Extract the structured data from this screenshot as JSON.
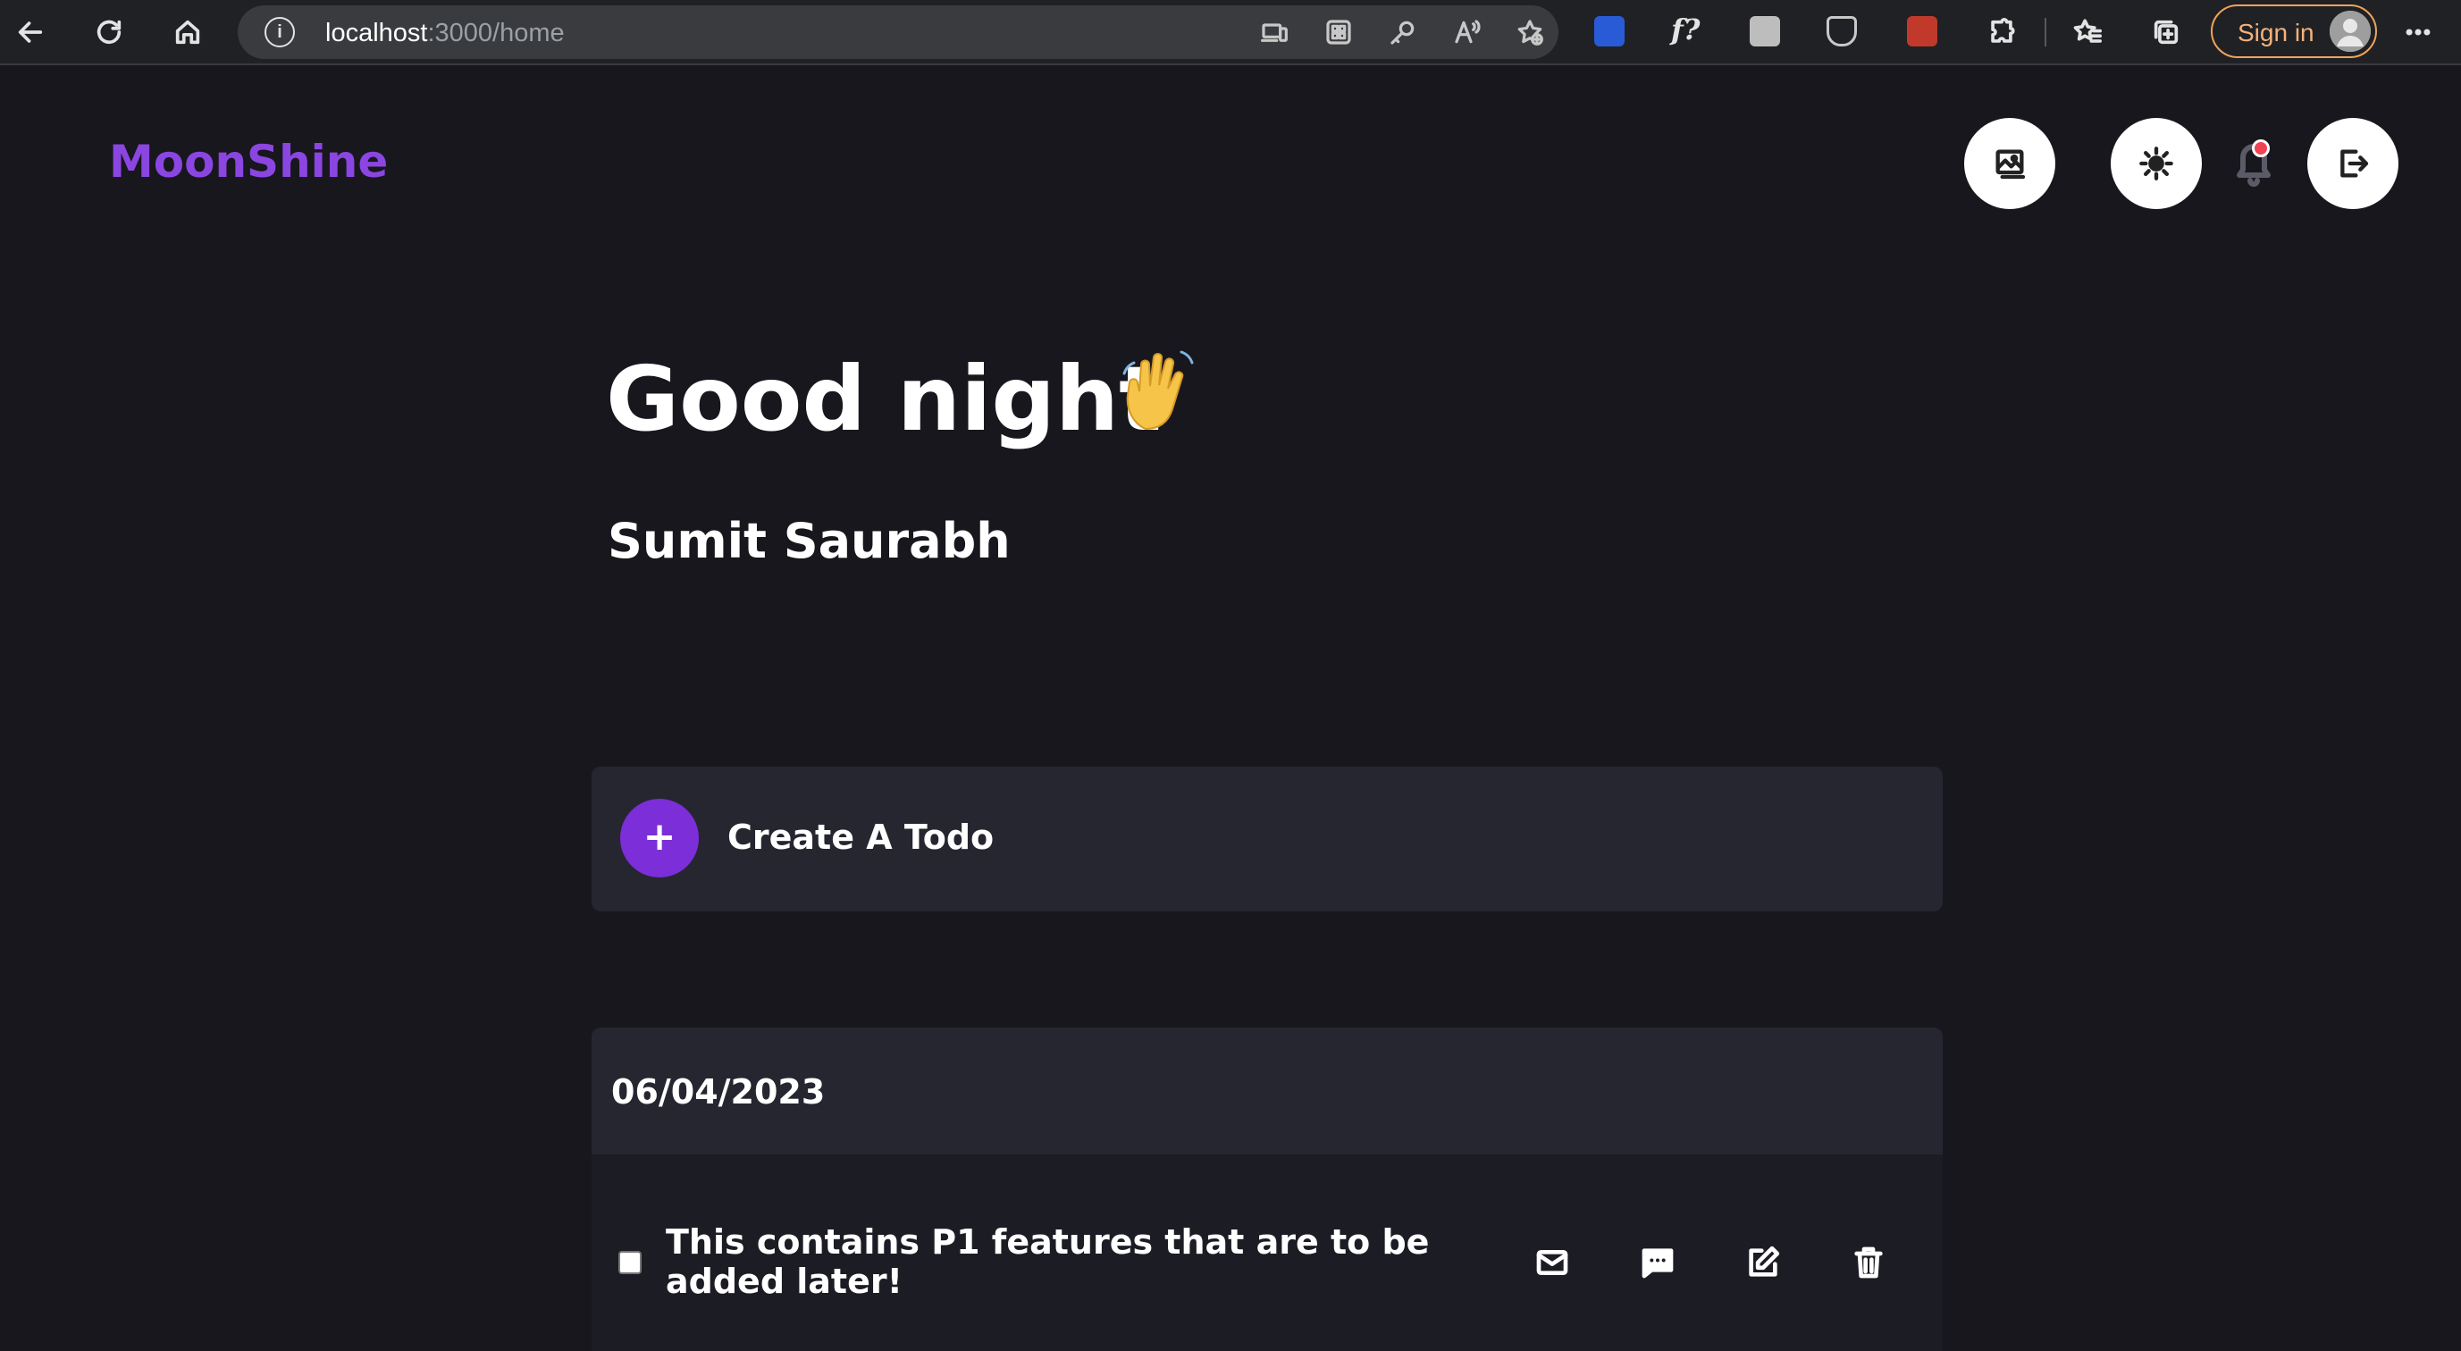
{
  "browser": {
    "url_host": "localhost",
    "url_path": ":3000/home",
    "signin_label": "Sign in",
    "icons": [
      "back-icon",
      "refresh-icon",
      "home-icon",
      "info-icon",
      "app-available-icon",
      "grid-icon",
      "key-icon",
      "read-aloud-icon",
      "add-favorite-icon",
      "extension-icons",
      "puzzle-icon",
      "favorites-icon",
      "collections-icon",
      "more-icon"
    ]
  },
  "app": {
    "brand": "MoonShine",
    "greeting": "Good night",
    "user_name": "Sumit Saurabh",
    "create_label": "Create A Todo",
    "create_symbol": "+",
    "accent_color": "#7c2ed8",
    "brand_color": "#8b45e0"
  },
  "todo_groups": [
    {
      "date": "06/04/2023",
      "items": [
        {
          "text": "This contains P1 features that are to be added later!",
          "checked": false,
          "actions": [
            "mail-icon",
            "comment-icon",
            "edit-icon",
            "trash-icon"
          ]
        }
      ]
    }
  ]
}
